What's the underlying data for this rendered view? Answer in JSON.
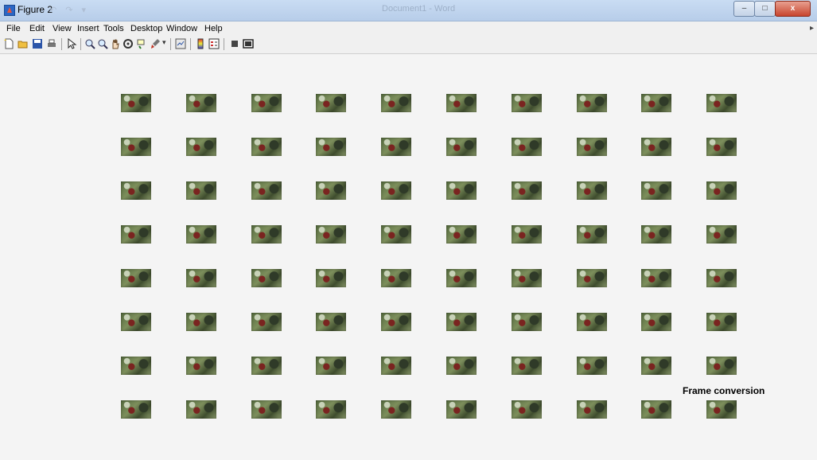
{
  "window": {
    "title": "Figure 2",
    "background_doc_title": "Document1 - Word",
    "buttons": {
      "minimize": "–",
      "maximize": "□",
      "close": "x"
    }
  },
  "menu": {
    "items": [
      "File",
      "Edit",
      "View",
      "Insert",
      "Tools",
      "Desktop",
      "Window",
      "Help"
    ]
  },
  "toolbar": {
    "icons": [
      "new-figure-icon",
      "open-file-icon",
      "save-icon",
      "print-icon",
      "pointer-icon",
      "zoom-in-icon",
      "zoom-out-icon",
      "pan-icon",
      "rotate-3d-icon",
      "data-cursor-icon",
      "brush-icon",
      "link-plot-icon",
      "colorbar-icon",
      "legend-icon",
      "hide-plot-tools-icon",
      "show-plot-tools-icon"
    ]
  },
  "figure": {
    "label": "Frame conversion",
    "rows": 8,
    "cols": 10,
    "frame_count": 80
  },
  "colors": {
    "titlebar": "#c9dcf3",
    "close_button": "#c8452e",
    "figure_background": "#f4f4f4"
  }
}
